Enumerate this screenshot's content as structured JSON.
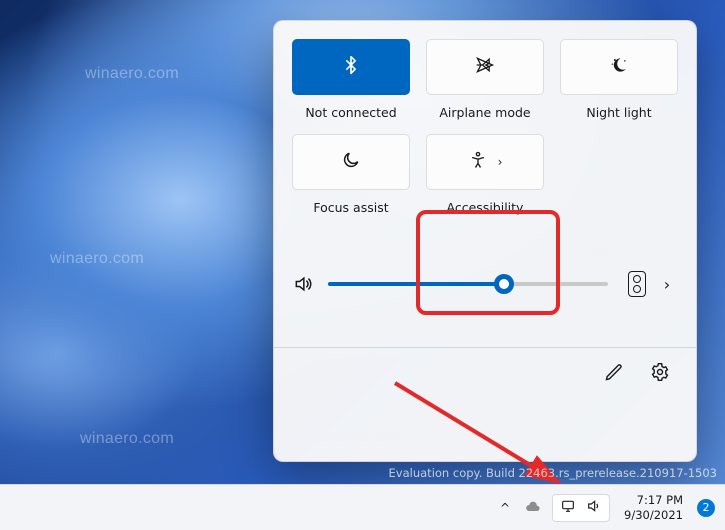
{
  "watermark": "winaero.com",
  "evaluation_line": "Evaluation copy. Build 22463.rs_prerelease.210917-1503",
  "panel": {
    "tiles": [
      {
        "id": "bluetooth",
        "label": "Not connected",
        "active": true,
        "has_chevron": false
      },
      {
        "id": "airplane",
        "label": "Airplane mode",
        "active": false,
        "has_chevron": false
      },
      {
        "id": "nightlight",
        "label": "Night light",
        "active": false,
        "has_chevron": false
      },
      {
        "id": "focus",
        "label": "Focus assist",
        "active": false,
        "has_chevron": false
      },
      {
        "id": "accessibility",
        "label": "Accessibility",
        "active": false,
        "has_chevron": true
      }
    ],
    "volume_percent": 63,
    "output_chevron": "›",
    "edit_label": "Edit quick settings",
    "settings_label": "Settings"
  },
  "taskbar": {
    "overflow_chevron": "^",
    "time": "7:17 PM",
    "date": "9/30/2021",
    "notification_count": "2"
  },
  "highlight": {
    "target_tile": "accessibility"
  }
}
